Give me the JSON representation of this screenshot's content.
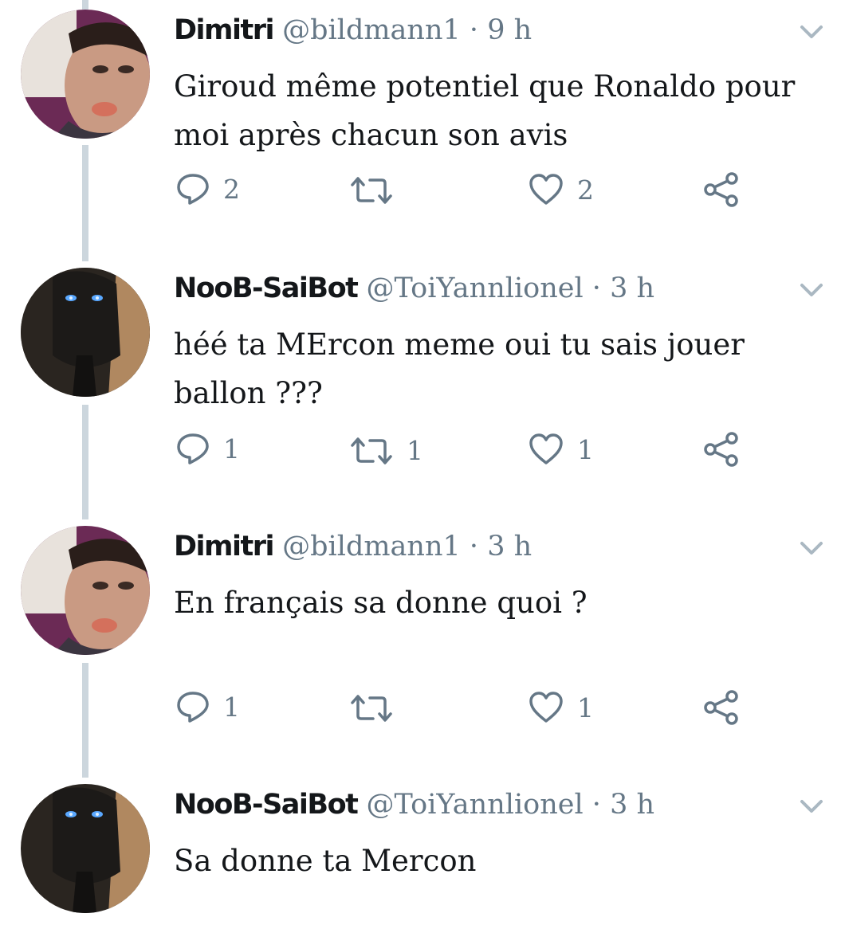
{
  "tweets": [
    {
      "name": "Dimitri",
      "handle": "@bildmann1",
      "separator": "·",
      "time": "9 h",
      "text_lines": [
        "Giroud même potentiel que Ronaldo pour",
        "moi après chacun son avis"
      ],
      "reply_count": "2",
      "retweet_count": "",
      "like_count": "2"
    },
    {
      "name": "NooB-SaiBot",
      "handle": "@ToiYannlionel",
      "separator": "·",
      "time": "3 h",
      "text_lines": [
        "héé ta MErcon meme oui tu sais jouer",
        "ballon ???"
      ],
      "reply_count": "1",
      "retweet_count": "1",
      "like_count": "1"
    },
    {
      "name": "Dimitri",
      "handle": "@bildmann1",
      "separator": "·",
      "time": "3 h",
      "text_lines": [
        "En français sa donne quoi ?"
      ],
      "reply_count": "1",
      "retweet_count": "",
      "like_count": "1"
    },
    {
      "name": "NooB-SaiBot",
      "handle": "@ToiYannlionel",
      "separator": "·",
      "time": "3 h",
      "text_lines": [
        "Sa donne ta Mercon"
      ]
    }
  ],
  "icons": {
    "reply": "reply-icon",
    "retweet": "retweet-icon",
    "like": "heart-icon",
    "share": "share-icon",
    "caret": "chevron-down-icon"
  },
  "colors": {
    "text": "#14171a",
    "secondary": "#657786",
    "thread_line": "#ccd6dd"
  }
}
